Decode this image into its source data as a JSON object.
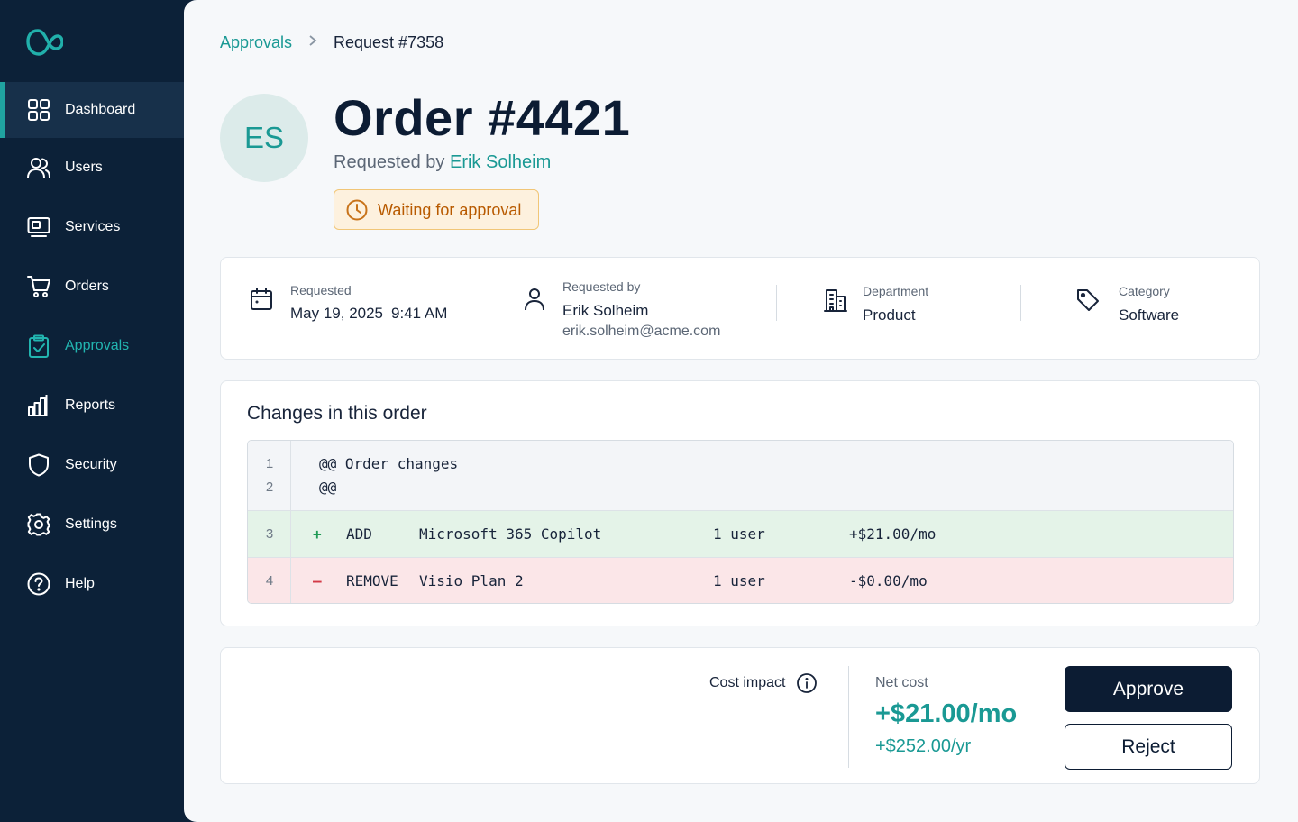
{
  "sidebar": {
    "items": [
      {
        "label": "Dashboard",
        "icon": "grid-icon"
      },
      {
        "label": "Users",
        "icon": "users-icon"
      },
      {
        "label": "Services",
        "icon": "monitor-icon"
      },
      {
        "label": "Orders",
        "icon": "cart-icon"
      },
      {
        "label": "Approvals",
        "icon": "clipboard-check-icon"
      },
      {
        "label": "Reports",
        "icon": "bar-chart-icon"
      },
      {
        "label": "Security",
        "icon": "shield-icon"
      },
      {
        "label": "Settings",
        "icon": "gear-icon"
      },
      {
        "label": "Help",
        "icon": "help-circle-icon"
      }
    ],
    "active_item": "Dashboard",
    "current_section": "Approvals"
  },
  "breadcrumb": {
    "parent": "Approvals",
    "separator": ">",
    "current": "Request #7358"
  },
  "header": {
    "avatar_initials": "ES",
    "title": "Order #4421",
    "requested_by_prefix": "Requested by",
    "requester_name": "Erik Solheim",
    "status": "Waiting for approval"
  },
  "info": {
    "requested": {
      "label": "Requested",
      "date": "May 19, 2025",
      "time": "9:41 AM"
    },
    "requested_by": {
      "label": "Requested by",
      "name": "Erik Solheim",
      "email": "erik.solheim@acme.com"
    },
    "department": {
      "label": "Department",
      "value": "Product"
    },
    "category": {
      "label": "Category",
      "value": "Software"
    }
  },
  "changes": {
    "title": "Changes in this order",
    "header_line_1": "@@ Order changes",
    "header_line_2": "@@",
    "rows": [
      {
        "line": "3",
        "sign": "+",
        "action": "ADD",
        "item": "Microsoft 365 Copilot",
        "qty": "1 user",
        "price": "+$21.00/mo"
      },
      {
        "line": "4",
        "sign": "–",
        "action": "REMOVE",
        "item": "Visio Plan 2",
        "qty": "1 user",
        "price": "-$0.00/mo"
      }
    ],
    "header_line_numbers": [
      "1",
      "2"
    ]
  },
  "cost": {
    "label": "Cost impact",
    "net_label": "Net cost",
    "net_monthly": "+$21.00/mo",
    "net_yearly": "+$252.00/yr"
  },
  "actions": {
    "approve": "Approve",
    "reject": "Reject"
  },
  "colors": {
    "accent": "#1a9994",
    "sidebar_bg": "#0c2138",
    "warning_text": "#b85a00",
    "add_bg": "#e4f3e8",
    "remove_bg": "#fbe6e8"
  }
}
